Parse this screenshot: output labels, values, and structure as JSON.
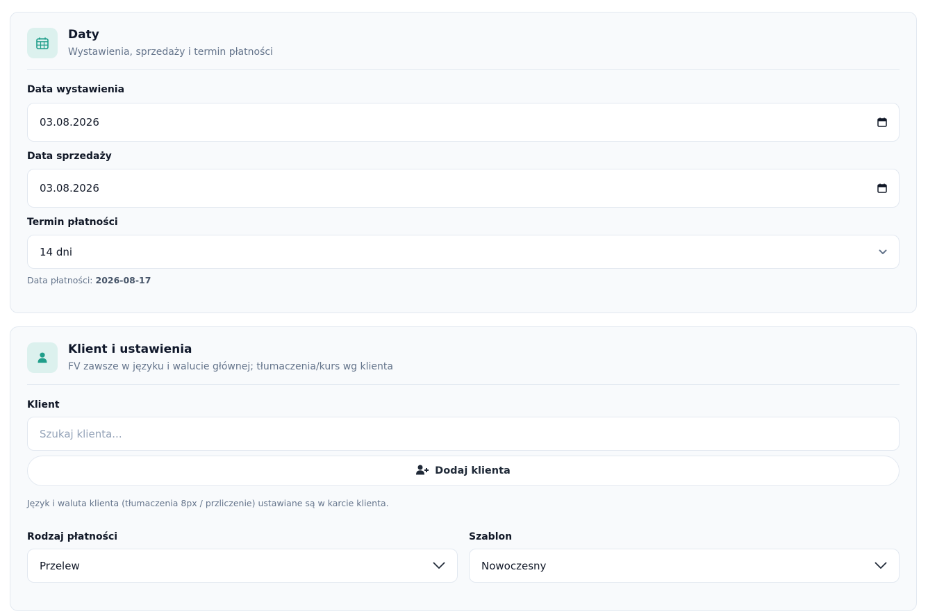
{
  "dates": {
    "icon": "calendar-icon",
    "title": "Daty",
    "subtitle": "Wystawienia, sprzedaży i termin płatności",
    "issue_date_label": "Data wystawienia",
    "issue_date_value": "03.08.2026",
    "sale_date_label": "Data sprzedaży",
    "sale_date_value": "03.08.2026",
    "payment_term_label": "Termin płatności",
    "payment_term_value": "14 dni",
    "payment_date_prefix": "Data płatności:",
    "payment_date_value": "2026-08-17"
  },
  "client": {
    "icon": "user-icon",
    "title": "Klient i ustawienia",
    "subtitle": "FV zawsze w języku i walucie głównej; tłumaczenia/kurs wg klienta",
    "client_label": "Klient",
    "search_placeholder": "Szukaj klienta...",
    "add_client_label": "Dodaj klienta",
    "note": "Język i waluta klienta (tłumaczenia 8px / przliczenie) ustawiane są w karcie klienta.",
    "payment_type_label": "Rodzaj płatności",
    "payment_type_value": "Przelew",
    "template_label": "Szablon",
    "template_value": "Nowoczesny"
  },
  "colors": {
    "accent": "#1f9e8a",
    "icon_bg": "#dcf1ee",
    "card_bg": "#f8fafc",
    "border": "#e2e8f0"
  }
}
